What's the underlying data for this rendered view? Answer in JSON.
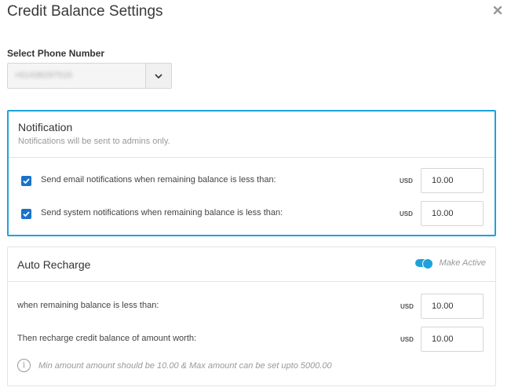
{
  "modal": {
    "title": "Credit Balance Settings"
  },
  "phone": {
    "label": "Select Phone Number",
    "value": "+61438297516"
  },
  "notification": {
    "title": "Notification",
    "subtitle": "Notifications will be sent to admins only.",
    "rows": [
      {
        "label": "Send email notifications when remaining balance is less than:",
        "checked": true,
        "currency": "USD",
        "amount": "10.00"
      },
      {
        "label": "Send system notifications when remaining balance is less than:",
        "checked": true,
        "currency": "USD",
        "amount": "10.00"
      }
    ]
  },
  "auto_recharge": {
    "title": "Auto Recharge",
    "toggle_label": "Make Active",
    "toggle_on": true,
    "rows": [
      {
        "label": "when remaining balance is less than:",
        "currency": "USD",
        "amount": "10.00"
      },
      {
        "label": "Then recharge credit balance of amount worth:",
        "currency": "USD",
        "amount": "10.00"
      }
    ],
    "info_icon": "i",
    "info": "Min amount amount should be 10.00 & Max amount can be set upto 5000.00"
  },
  "colors": {
    "accent": "#1ea1db",
    "checkbox": "#1a73c9"
  }
}
